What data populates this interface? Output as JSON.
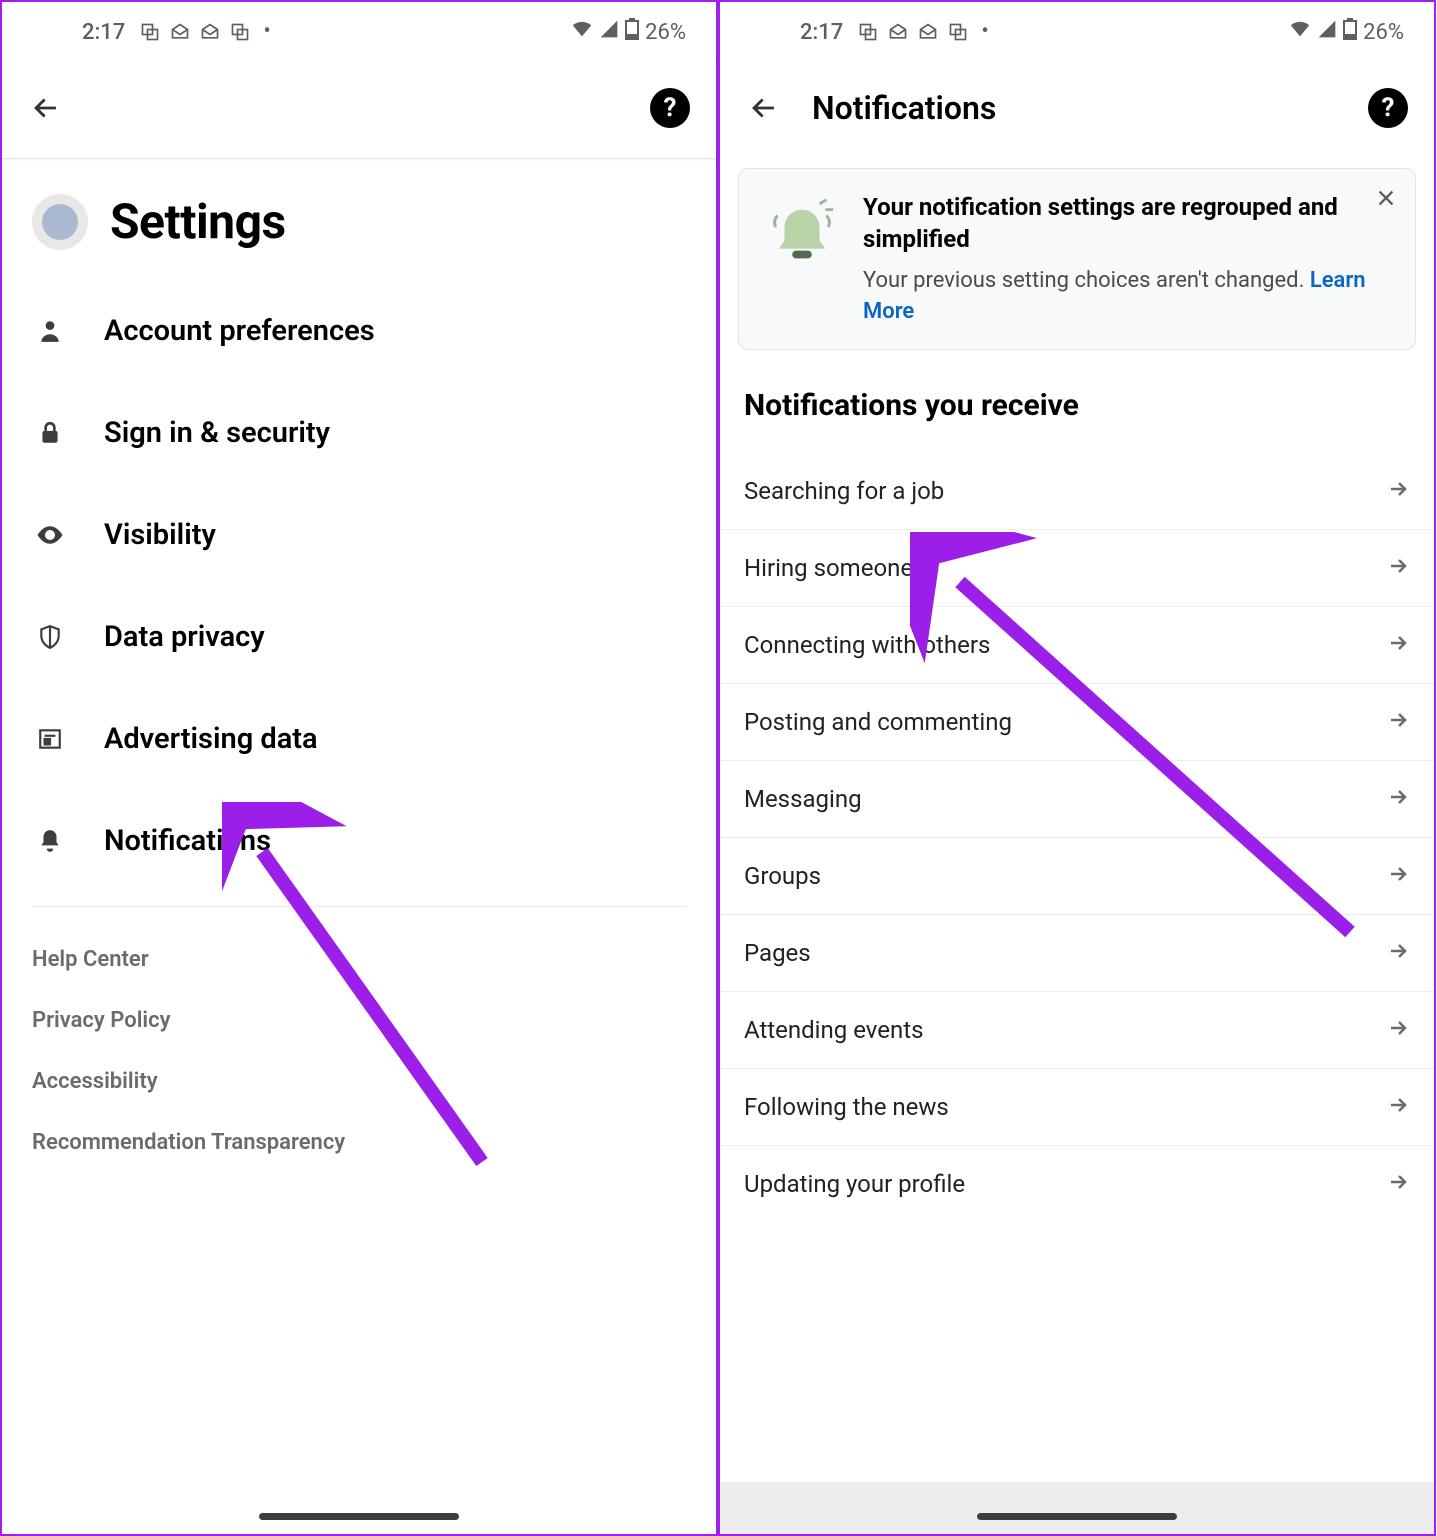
{
  "status": {
    "time": "2:17",
    "battery": "26%"
  },
  "left": {
    "page_title": "Settings",
    "items": [
      {
        "label": "Account preferences"
      },
      {
        "label": "Sign in & security"
      },
      {
        "label": "Visibility"
      },
      {
        "label": "Data privacy"
      },
      {
        "label": "Advertising data"
      },
      {
        "label": "Notifications"
      }
    ],
    "footer_links": [
      {
        "label": "Help Center"
      },
      {
        "label": "Privacy Policy"
      },
      {
        "label": "Accessibility"
      },
      {
        "label": "Recommendation Transparency"
      }
    ]
  },
  "right": {
    "page_title": "Notifications",
    "banner": {
      "title": "Your notification settings are regrouped and simplified",
      "subtitle_prefix": "Your previous setting choices aren't changed. ",
      "learn_more": "Learn More"
    },
    "section_title": "Notifications you receive",
    "items": [
      {
        "label": "Searching for a job"
      },
      {
        "label": "Hiring someone"
      },
      {
        "label": "Connecting with others"
      },
      {
        "label": "Posting and commenting"
      },
      {
        "label": "Messaging"
      },
      {
        "label": "Groups"
      },
      {
        "label": "Pages"
      },
      {
        "label": "Attending events"
      },
      {
        "label": "Following the news"
      },
      {
        "label": "Updating your profile"
      }
    ]
  }
}
